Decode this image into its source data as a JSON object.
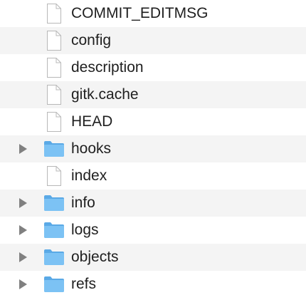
{
  "items": [
    {
      "name": "COMMIT_EDITMSG",
      "type": "file"
    },
    {
      "name": "config",
      "type": "file"
    },
    {
      "name": "description",
      "type": "file"
    },
    {
      "name": "gitk.cache",
      "type": "file"
    },
    {
      "name": "HEAD",
      "type": "file"
    },
    {
      "name": "hooks",
      "type": "folder"
    },
    {
      "name": "index",
      "type": "file"
    },
    {
      "name": "info",
      "type": "folder"
    },
    {
      "name": "logs",
      "type": "folder"
    },
    {
      "name": "objects",
      "type": "folder"
    },
    {
      "name": "refs",
      "type": "folder"
    }
  ],
  "colors": {
    "alt_row": "#f4f4f4",
    "folder_fill": "#7cc2f4",
    "folder_tab": "#5aa9e6",
    "disclosure": "#808080",
    "file_stroke": "#b8b8b8"
  }
}
